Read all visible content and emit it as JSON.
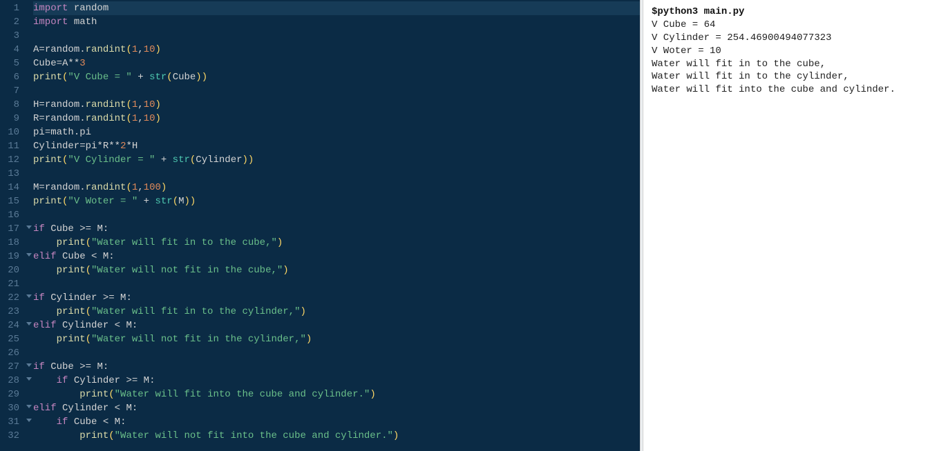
{
  "editor": {
    "lines": [
      {
        "n": 1,
        "fold": false,
        "active": true,
        "tokens": [
          {
            "t": "import",
            "c": "keyword"
          },
          {
            "t": " ",
            "c": "op"
          },
          {
            "t": "random",
            "c": "ident"
          }
        ]
      },
      {
        "n": 2,
        "fold": false,
        "tokens": [
          {
            "t": "import",
            "c": "keyword"
          },
          {
            "t": " ",
            "c": "op"
          },
          {
            "t": "math",
            "c": "ident"
          }
        ]
      },
      {
        "n": 3,
        "fold": false,
        "tokens": []
      },
      {
        "n": 4,
        "fold": false,
        "tokens": [
          {
            "t": "A",
            "c": "ident"
          },
          {
            "t": "=",
            "c": "op"
          },
          {
            "t": "random",
            "c": "ident"
          },
          {
            "t": ".",
            "c": "dot"
          },
          {
            "t": "randint",
            "c": "func"
          },
          {
            "t": "(",
            "c": "paren"
          },
          {
            "t": "1",
            "c": "number"
          },
          {
            "t": ",",
            "c": "op"
          },
          {
            "t": "10",
            "c": "number"
          },
          {
            "t": ")",
            "c": "paren"
          }
        ]
      },
      {
        "n": 5,
        "fold": false,
        "tokens": [
          {
            "t": "Cube",
            "c": "ident"
          },
          {
            "t": "=",
            "c": "op"
          },
          {
            "t": "A",
            "c": "ident"
          },
          {
            "t": "**",
            "c": "op"
          },
          {
            "t": "3",
            "c": "number"
          }
        ]
      },
      {
        "n": 6,
        "fold": false,
        "tokens": [
          {
            "t": "print",
            "c": "func"
          },
          {
            "t": "(",
            "c": "paren"
          },
          {
            "t": "\"V Cube = \"",
            "c": "string"
          },
          {
            "t": " + ",
            "c": "op"
          },
          {
            "t": "str",
            "c": "builtin"
          },
          {
            "t": "(",
            "c": "paren"
          },
          {
            "t": "Cube",
            "c": "ident"
          },
          {
            "t": ")",
            "c": "paren"
          },
          {
            "t": ")",
            "c": "paren"
          }
        ]
      },
      {
        "n": 7,
        "fold": false,
        "tokens": []
      },
      {
        "n": 8,
        "fold": false,
        "tokens": [
          {
            "t": "H",
            "c": "ident"
          },
          {
            "t": "=",
            "c": "op"
          },
          {
            "t": "random",
            "c": "ident"
          },
          {
            "t": ".",
            "c": "dot"
          },
          {
            "t": "randint",
            "c": "func"
          },
          {
            "t": "(",
            "c": "paren"
          },
          {
            "t": "1",
            "c": "number"
          },
          {
            "t": ",",
            "c": "op"
          },
          {
            "t": "10",
            "c": "number"
          },
          {
            "t": ")",
            "c": "paren"
          }
        ]
      },
      {
        "n": 9,
        "fold": false,
        "tokens": [
          {
            "t": "R",
            "c": "ident"
          },
          {
            "t": "=",
            "c": "op"
          },
          {
            "t": "random",
            "c": "ident"
          },
          {
            "t": ".",
            "c": "dot"
          },
          {
            "t": "randint",
            "c": "func"
          },
          {
            "t": "(",
            "c": "paren"
          },
          {
            "t": "1",
            "c": "number"
          },
          {
            "t": ",",
            "c": "op"
          },
          {
            "t": "10",
            "c": "number"
          },
          {
            "t": ")",
            "c": "paren"
          }
        ]
      },
      {
        "n": 10,
        "fold": false,
        "tokens": [
          {
            "t": "pi",
            "c": "ident"
          },
          {
            "t": "=",
            "c": "op"
          },
          {
            "t": "math",
            "c": "ident"
          },
          {
            "t": ".",
            "c": "dot"
          },
          {
            "t": "pi",
            "c": "ident"
          }
        ]
      },
      {
        "n": 11,
        "fold": false,
        "tokens": [
          {
            "t": "Cylinder",
            "c": "ident"
          },
          {
            "t": "=",
            "c": "op"
          },
          {
            "t": "pi",
            "c": "ident"
          },
          {
            "t": "*",
            "c": "op"
          },
          {
            "t": "R",
            "c": "ident"
          },
          {
            "t": "**",
            "c": "op"
          },
          {
            "t": "2",
            "c": "number"
          },
          {
            "t": "*",
            "c": "op"
          },
          {
            "t": "H",
            "c": "ident"
          }
        ]
      },
      {
        "n": 12,
        "fold": false,
        "tokens": [
          {
            "t": "print",
            "c": "func"
          },
          {
            "t": "(",
            "c": "paren"
          },
          {
            "t": "\"V Cylinder = \"",
            "c": "string"
          },
          {
            "t": " + ",
            "c": "op"
          },
          {
            "t": "str",
            "c": "builtin"
          },
          {
            "t": "(",
            "c": "paren"
          },
          {
            "t": "Cylinder",
            "c": "ident"
          },
          {
            "t": ")",
            "c": "paren"
          },
          {
            "t": ")",
            "c": "paren"
          }
        ]
      },
      {
        "n": 13,
        "fold": false,
        "tokens": []
      },
      {
        "n": 14,
        "fold": false,
        "tokens": [
          {
            "t": "M",
            "c": "ident"
          },
          {
            "t": "=",
            "c": "op"
          },
          {
            "t": "random",
            "c": "ident"
          },
          {
            "t": ".",
            "c": "dot"
          },
          {
            "t": "randint",
            "c": "func"
          },
          {
            "t": "(",
            "c": "paren"
          },
          {
            "t": "1",
            "c": "number"
          },
          {
            "t": ",",
            "c": "op"
          },
          {
            "t": "100",
            "c": "number"
          },
          {
            "t": ")",
            "c": "paren"
          }
        ]
      },
      {
        "n": 15,
        "fold": false,
        "tokens": [
          {
            "t": "print",
            "c": "func"
          },
          {
            "t": "(",
            "c": "paren"
          },
          {
            "t": "\"V Woter = \"",
            "c": "string"
          },
          {
            "t": " + ",
            "c": "op"
          },
          {
            "t": "str",
            "c": "builtin"
          },
          {
            "t": "(",
            "c": "paren"
          },
          {
            "t": "M",
            "c": "ident"
          },
          {
            "t": ")",
            "c": "paren"
          },
          {
            "t": ")",
            "c": "paren"
          }
        ]
      },
      {
        "n": 16,
        "fold": false,
        "tokens": []
      },
      {
        "n": 17,
        "fold": true,
        "tokens": [
          {
            "t": "if",
            "c": "keyword"
          },
          {
            "t": " ",
            "c": "op"
          },
          {
            "t": "Cube",
            "c": "ident"
          },
          {
            "t": " >= ",
            "c": "op"
          },
          {
            "t": "M",
            "c": "ident"
          },
          {
            "t": ":",
            "c": "op"
          }
        ]
      },
      {
        "n": 18,
        "fold": false,
        "tokens": [
          {
            "t": "    ",
            "c": "op"
          },
          {
            "t": "print",
            "c": "func"
          },
          {
            "t": "(",
            "c": "paren"
          },
          {
            "t": "\"Water will fit in to the cube,\"",
            "c": "string"
          },
          {
            "t": ")",
            "c": "paren"
          }
        ]
      },
      {
        "n": 19,
        "fold": true,
        "tokens": [
          {
            "t": "elif",
            "c": "keyword"
          },
          {
            "t": " ",
            "c": "op"
          },
          {
            "t": "Cube",
            "c": "ident"
          },
          {
            "t": " < ",
            "c": "op"
          },
          {
            "t": "M",
            "c": "ident"
          },
          {
            "t": ":",
            "c": "op"
          }
        ]
      },
      {
        "n": 20,
        "fold": false,
        "tokens": [
          {
            "t": "    ",
            "c": "op"
          },
          {
            "t": "print",
            "c": "func"
          },
          {
            "t": "(",
            "c": "paren"
          },
          {
            "t": "\"Water will not fit in the cube,\"",
            "c": "string"
          },
          {
            "t": ")",
            "c": "paren"
          }
        ]
      },
      {
        "n": 21,
        "fold": false,
        "tokens": []
      },
      {
        "n": 22,
        "fold": true,
        "tokens": [
          {
            "t": "if",
            "c": "keyword"
          },
          {
            "t": " ",
            "c": "op"
          },
          {
            "t": "Cylinder",
            "c": "ident"
          },
          {
            "t": " >= ",
            "c": "op"
          },
          {
            "t": "M",
            "c": "ident"
          },
          {
            "t": ":",
            "c": "op"
          }
        ]
      },
      {
        "n": 23,
        "fold": false,
        "tokens": [
          {
            "t": "    ",
            "c": "op"
          },
          {
            "t": "print",
            "c": "func"
          },
          {
            "t": "(",
            "c": "paren"
          },
          {
            "t": "\"Water will fit in to the cylinder,\"",
            "c": "string"
          },
          {
            "t": ")",
            "c": "paren"
          }
        ]
      },
      {
        "n": 24,
        "fold": true,
        "tokens": [
          {
            "t": "elif",
            "c": "keyword"
          },
          {
            "t": " ",
            "c": "op"
          },
          {
            "t": "Cylinder",
            "c": "ident"
          },
          {
            "t": " < ",
            "c": "op"
          },
          {
            "t": "M",
            "c": "ident"
          },
          {
            "t": ":",
            "c": "op"
          }
        ]
      },
      {
        "n": 25,
        "fold": false,
        "tokens": [
          {
            "t": "    ",
            "c": "op"
          },
          {
            "t": "print",
            "c": "func"
          },
          {
            "t": "(",
            "c": "paren"
          },
          {
            "t": "\"Water will not fit in the cylinder,\"",
            "c": "string"
          },
          {
            "t": ")",
            "c": "paren"
          }
        ]
      },
      {
        "n": 26,
        "fold": false,
        "tokens": []
      },
      {
        "n": 27,
        "fold": true,
        "tokens": [
          {
            "t": "if",
            "c": "keyword"
          },
          {
            "t": " ",
            "c": "op"
          },
          {
            "t": "Cube",
            "c": "ident"
          },
          {
            "t": " >= ",
            "c": "op"
          },
          {
            "t": "M",
            "c": "ident"
          },
          {
            "t": ":",
            "c": "op"
          }
        ]
      },
      {
        "n": 28,
        "fold": true,
        "tokens": [
          {
            "t": "    ",
            "c": "op"
          },
          {
            "t": "if",
            "c": "keyword"
          },
          {
            "t": " ",
            "c": "op"
          },
          {
            "t": "Cylinder",
            "c": "ident"
          },
          {
            "t": " >= ",
            "c": "op"
          },
          {
            "t": "M",
            "c": "ident"
          },
          {
            "t": ":",
            "c": "op"
          }
        ]
      },
      {
        "n": 29,
        "fold": false,
        "tokens": [
          {
            "t": "        ",
            "c": "op"
          },
          {
            "t": "print",
            "c": "func"
          },
          {
            "t": "(",
            "c": "paren"
          },
          {
            "t": "\"Water will fit into the cube and cylinder.\"",
            "c": "string"
          },
          {
            "t": ")",
            "c": "paren"
          }
        ]
      },
      {
        "n": 30,
        "fold": true,
        "tokens": [
          {
            "t": "elif",
            "c": "keyword"
          },
          {
            "t": " ",
            "c": "op"
          },
          {
            "t": "Cylinder",
            "c": "ident"
          },
          {
            "t": " < ",
            "c": "op"
          },
          {
            "t": "M",
            "c": "ident"
          },
          {
            "t": ":",
            "c": "op"
          }
        ]
      },
      {
        "n": 31,
        "fold": true,
        "tokens": [
          {
            "t": "    ",
            "c": "op"
          },
          {
            "t": "if",
            "c": "keyword"
          },
          {
            "t": " ",
            "c": "op"
          },
          {
            "t": "Cube",
            "c": "ident"
          },
          {
            "t": " < ",
            "c": "op"
          },
          {
            "t": "M",
            "c": "ident"
          },
          {
            "t": ":",
            "c": "op"
          }
        ]
      },
      {
        "n": 32,
        "fold": false,
        "tokens": [
          {
            "t": "        ",
            "c": "op"
          },
          {
            "t": "print",
            "c": "func"
          },
          {
            "t": "(",
            "c": "paren"
          },
          {
            "t": "\"Water will not fit into the cube and cylinder.\"",
            "c": "string"
          },
          {
            "t": ")",
            "c": "paren"
          }
        ]
      }
    ]
  },
  "output": {
    "command": "$python3 main.py",
    "lines": [
      "V Cube = 64",
      "V Cylinder = 254.46900494077323",
      "V Woter = 10",
      "Water will fit in to the cube,",
      "Water will fit in to the cylinder,",
      "Water will fit into the cube and cylinder."
    ]
  }
}
